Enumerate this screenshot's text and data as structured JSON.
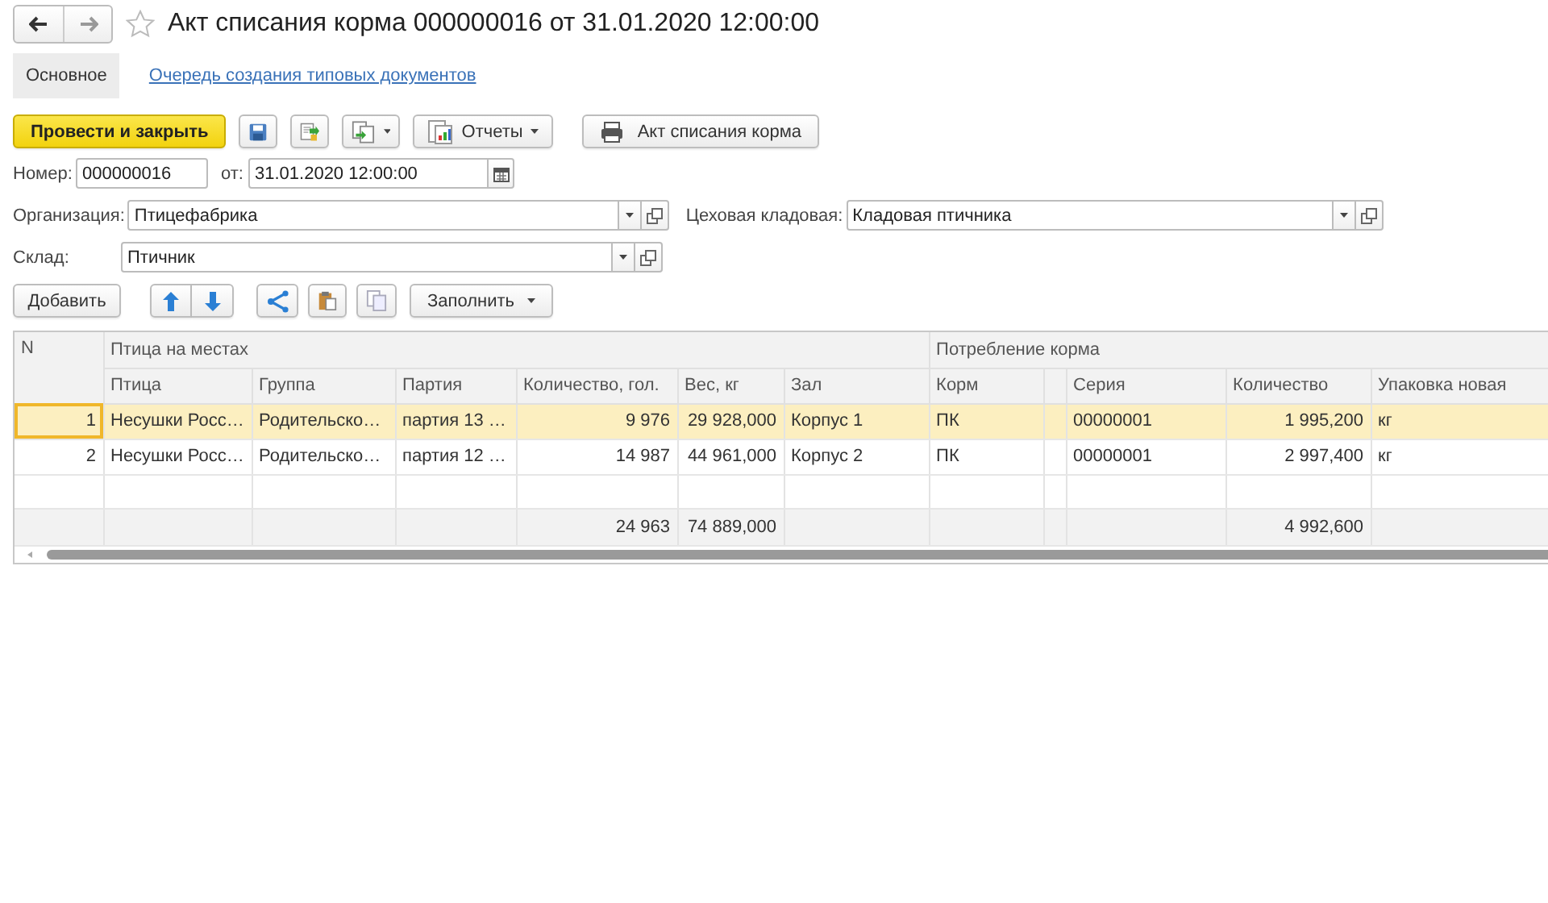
{
  "window": {
    "title": "Акт списания корма 000000016 от 31.01.2020 12:00:00",
    "favorite": false
  },
  "nav_tabs": [
    {
      "label": "Основное",
      "selected": true
    },
    {
      "label": "Очередь создания типовых документов",
      "selected": false
    }
  ],
  "toolbar": {
    "primary": "Провести и закрыть",
    "reports": "Отчеты",
    "print": "Акт списания корма"
  },
  "header_fields": {
    "number_label": "Номер:",
    "number": "000000016",
    "date_label": "от:",
    "date": "31.01.2020 12:00:00"
  },
  "organization": {
    "label": "Организация:",
    "value": "Птицефабрика"
  },
  "shop_storage": {
    "label": "Цеховая кладовая:",
    "value": "Кладовая птичника"
  },
  "warehouse": {
    "label": "Склад:",
    "value": "Птичник"
  },
  "table_toolbar": {
    "add": "Добавить",
    "fill": "Заполнить"
  },
  "table": {
    "number_column": "N",
    "column_groups": [
      {
        "label": "Птица на местах",
        "columns": [
          {
            "label": "Птица",
            "kind": "text"
          },
          {
            "label": "Группа",
            "kind": "text"
          },
          {
            "label": "Партия",
            "kind": "text"
          },
          {
            "label": "Количество, гол.",
            "kind": "number",
            "total": "24 963"
          },
          {
            "label": "Вес, кг",
            "kind": "number",
            "total": "74 889,000"
          },
          {
            "label": "Зал",
            "kind": "text"
          }
        ]
      },
      {
        "label": "Потребление корма",
        "columns": [
          {
            "label": "Корм",
            "kind": "text"
          },
          {
            "kind": "spacer"
          },
          {
            "label": "Серия",
            "kind": "text"
          },
          {
            "label": "Количество",
            "kind": "number",
            "total": "4 992,600"
          },
          {
            "label": "Упаковка новая",
            "kind": "text"
          }
        ]
      }
    ],
    "rows": [
      {
        "number": "1",
        "selected": true,
        "cells": [
          "Несушки Росс…",
          "Родительско…",
          "партия 13 …",
          "9 976",
          "29 928,000",
          "Корпус 1",
          "ПК",
          "00000001",
          "1 995,200",
          "кг"
        ]
      },
      {
        "number": "2",
        "selected": false,
        "cells": [
          "Несушки Росс…",
          "Родительско…",
          "партия 12 …",
          "14 987",
          "44 961,000",
          "Корпус 2",
          "ПК",
          "00000001",
          "2 997,400",
          "кг"
        ]
      }
    ]
  }
}
